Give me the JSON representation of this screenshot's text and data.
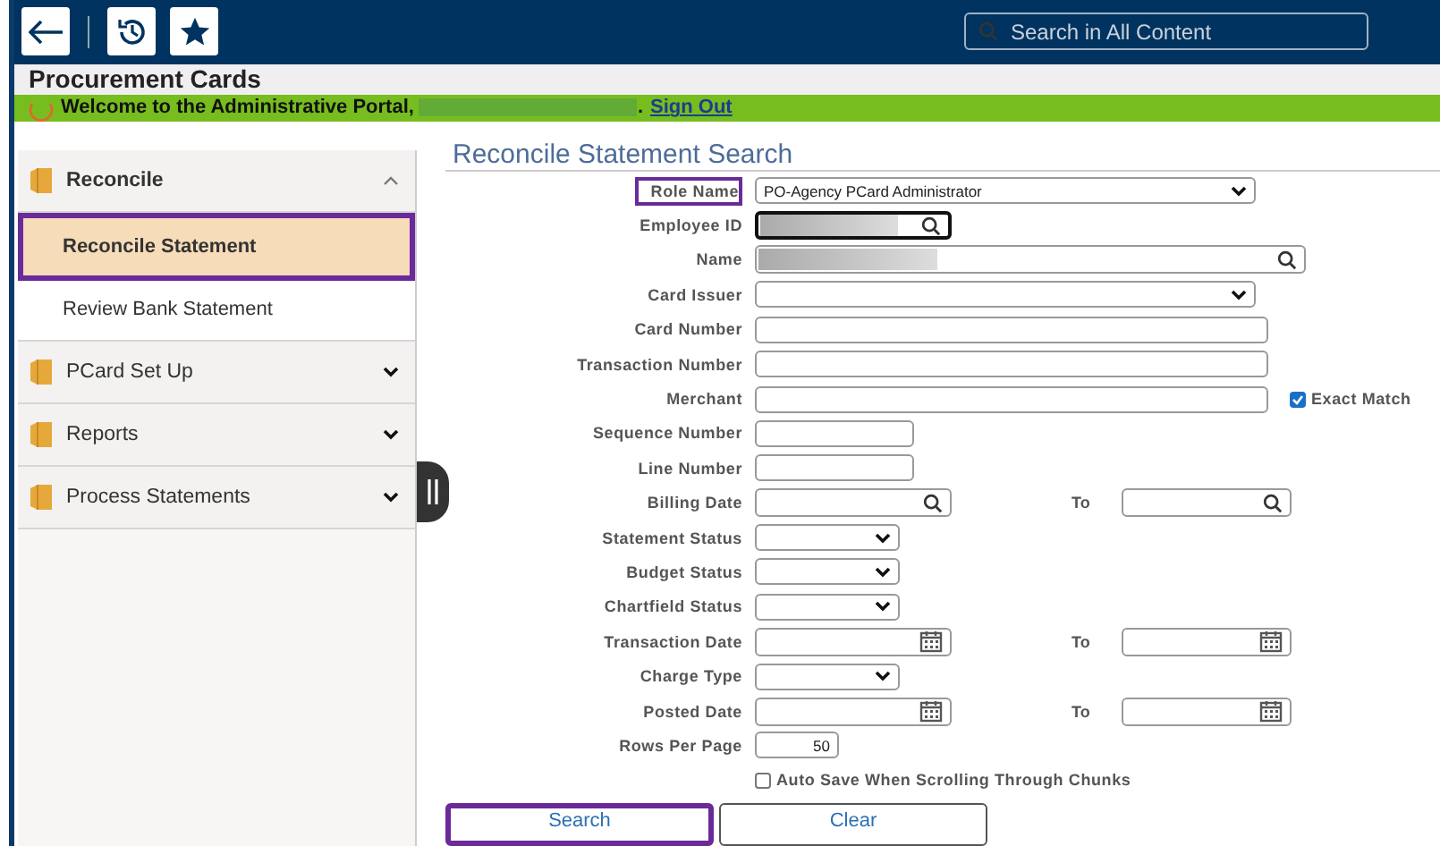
{
  "header": {
    "search": {
      "placeholder": "Search in All Content"
    }
  },
  "title": "Procurement Cards",
  "banner": {
    "text": "Welcome to the Administrative Portal,",
    "redacted": true,
    "suffix": ".",
    "link": "Sign Out"
  },
  "sidebar": {
    "groups": [
      {
        "label": "Reconcile",
        "expanded": true,
        "items": [
          {
            "label": "Reconcile Statement",
            "selected": true,
            "highlighted": true
          },
          {
            "label": "Review Bank Statement",
            "selected": false,
            "highlighted": false
          }
        ]
      },
      {
        "label": "PCard Set Up",
        "expanded": false
      },
      {
        "label": "Reports",
        "expanded": false
      },
      {
        "label": "Process Statements",
        "expanded": false
      }
    ]
  },
  "form": {
    "heading": "Reconcile Statement Search",
    "rows": [
      {
        "label": "Role Name",
        "highlighted": true,
        "field": {
          "kind": "select",
          "value": "PO-Agency PCard Administrator"
        }
      },
      {
        "label": "Employee ID",
        "highlighted": false,
        "field": {
          "kind": "lookup",
          "redacted": true,
          "focused": true
        }
      },
      {
        "label": "Name",
        "highlighted": false,
        "field": {
          "kind": "lookup",
          "redacted": true
        }
      },
      {
        "label": "Card Issuer",
        "highlighted": false,
        "field": {
          "kind": "select"
        }
      },
      {
        "label": "Card Number",
        "highlighted": false,
        "field": {
          "kind": "text"
        }
      },
      {
        "label": "Transaction Number",
        "highlighted": false,
        "field": {
          "kind": "text"
        }
      },
      {
        "label": "Merchant",
        "highlighted": false,
        "field": {
          "kind": "text"
        },
        "option": {
          "label": "Exact Match",
          "checked": true
        }
      },
      {
        "label": "Sequence Number",
        "highlighted": false,
        "field": {
          "kind": "text"
        }
      },
      {
        "label": "Line Number",
        "highlighted": false,
        "field": {
          "kind": "text"
        }
      },
      {
        "label": "Billing Date",
        "highlighted": false,
        "field": {
          "kind": "lookup"
        },
        "to": {
          "label": "To",
          "kind": "lookup"
        }
      },
      {
        "label": "Statement Status",
        "highlighted": false,
        "field": {
          "kind": "select"
        }
      },
      {
        "label": "Budget Status",
        "highlighted": false,
        "field": {
          "kind": "select"
        }
      },
      {
        "label": "Chartfield Status",
        "highlighted": false,
        "field": {
          "kind": "select"
        }
      },
      {
        "label": "Transaction Date",
        "highlighted": false,
        "field": {
          "kind": "calendar"
        },
        "to": {
          "label": "To",
          "kind": "calendar"
        }
      },
      {
        "label": "Charge Type",
        "highlighted": false,
        "field": {
          "kind": "select"
        }
      },
      {
        "label": "Posted Date",
        "highlighted": false,
        "field": {
          "kind": "calendar"
        },
        "to": {
          "label": "To",
          "kind": "calendar"
        }
      },
      {
        "label": "Rows Per Page",
        "highlighted": false,
        "field": {
          "kind": "number",
          "value": "50"
        }
      }
    ],
    "auto_save": {
      "label": "Auto Save When Scrolling Through Chunks",
      "checked": false
    },
    "buttons": [
      {
        "label": "Search",
        "highlighted": true
      },
      {
        "label": "Clear",
        "highlighted": false
      }
    ]
  }
}
